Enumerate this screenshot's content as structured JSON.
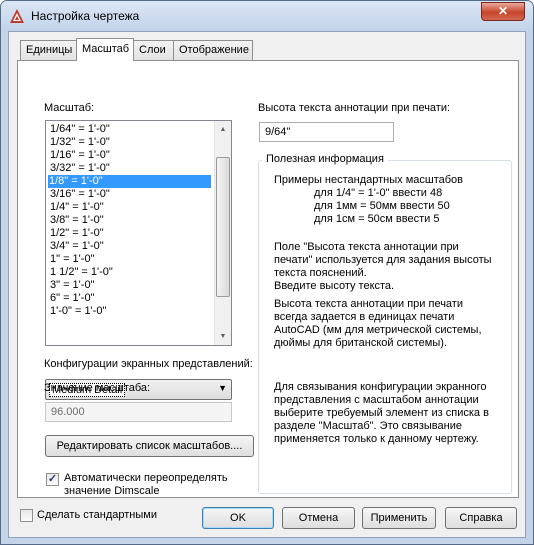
{
  "window": {
    "title": "Настройка чертежа",
    "close_glyph": "✕"
  },
  "tabs": [
    {
      "label": "Единицы",
      "active": false
    },
    {
      "label": "Масштаб",
      "active": true
    },
    {
      "label": "Слои",
      "active": false
    },
    {
      "label": "Отображение",
      "active": false
    }
  ],
  "scale": {
    "label": "Масштаб:",
    "items": [
      "1/64\" = 1'-0\"",
      "1/32\" = 1'-0\"",
      "1/16\" = 1'-0\"",
      "3/32\" = 1'-0\"",
      "1/8\" = 1'-0\"",
      "3/16\" = 1'-0\"",
      "1/4\" = 1'-0\"",
      "3/8\" = 1'-0\"",
      "1/2\" = 1'-0\"",
      "3/4\" = 1'-0\"",
      "1\" = 1'-0\"",
      "1 1/2\" = 1'-0\"",
      "3\" = 1'-0\"",
      "6\" = 1'-0\"",
      "1'-0\" = 1'-0\""
    ],
    "selected_index": 4
  },
  "display_config": {
    "label": "Конфигурации экранных представлений:",
    "value": "Medium Detail"
  },
  "scale_value": {
    "label": "Значение масштаба:",
    "value": "96.000"
  },
  "edit_scales_button": "Редактировать список масштабов....",
  "auto_override": {
    "checked": true,
    "line1": "Автоматически переопределять",
    "line2": "значение Dimscale"
  },
  "annotation_height": {
    "label": "Высота текста аннотации при печати:",
    "value": "9/64\""
  },
  "info": {
    "title": "Полезная информация",
    "lines": [
      "Примеры нестандартных масштабов",
      "для 1/4\" = 1'-0\" ввести 48",
      "для 1мм = 50мм ввести 50",
      "для 1см = 50см ввести 5",
      "Поле \"Высота текста аннотации при",
      "печати\" используется для задания высоты",
      "текста пояснений.",
      "Введите высоту текста.",
      "Высота текста аннотации при печати",
      "всегда задается в единицах печати",
      "AutoCAD (мм для метрической системы,",
      "дюймы для британской системы).",
      "Для связывания конфигурации экранного",
      "представления с масштабом аннотации",
      "выберите требуемый элемент из списка в",
      "разделе \"Масштаб\". Это связывание",
      "применяется только к данному чертежу."
    ]
  },
  "footer": {
    "make_default": "Сделать стандартными",
    "make_default_checked": false,
    "ok": "OK",
    "cancel": "Отмена",
    "apply": "Применить",
    "help": "Справка"
  },
  "colors": {
    "selection": "#3399ff",
    "app_icon": "#c0392b"
  },
  "icons": {
    "app": "autocad-logo-icon",
    "close": "close-icon",
    "dropdown": "chevron-down-icon",
    "checkbox": "checkmark-icon"
  }
}
